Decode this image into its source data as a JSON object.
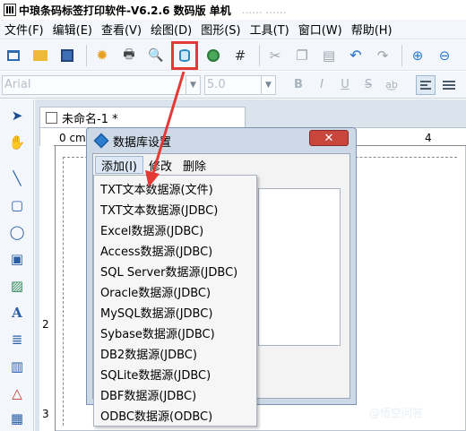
{
  "window": {
    "title": "中琅条码标签打印软件-V6.2.6 数码版 单机",
    "title_faded": "...... ......"
  },
  "menubar": {
    "items": [
      "文件(F)",
      "编辑(E)",
      "查看(V)",
      "绘图(D)",
      "图形(S)",
      "工具(T)",
      "窗口(W)",
      "帮助(H)"
    ]
  },
  "toolbar2": {
    "font_name": "Arial",
    "font_size": "5.0",
    "bold": "B",
    "italic": "I",
    "underline": "U",
    "strike": "S"
  },
  "document": {
    "tab_title": "未命名-1 *",
    "ruler_origin": "0 cm",
    "ruler_h4": "4",
    "ruler_v2": "2",
    "ruler_v3": "3"
  },
  "dialog": {
    "title": "数据库设置",
    "close_label": "✕",
    "menu": [
      "添加(I)",
      "修改",
      "删除"
    ]
  },
  "dropdown": {
    "items": [
      "TXT文本数据源(文件)",
      "TXT文本数据源(JDBC)",
      "Excel数据源(JDBC)",
      "Access数据源(JDBC)",
      "SQL Server数据源(JDBC)",
      "Oracle数据源(JDBC)",
      "MySQL数据源(JDBC)",
      "Sybase数据源(JDBC)",
      "DB2数据源(JDBC)",
      "SQLite数据源(JDBC)",
      "DBF数据源(JDBC)",
      "ODBC数据源(ODBC)"
    ]
  },
  "watermark": "@悟空问答",
  "colors": {
    "highlight": "#e53935",
    "arrow": "#e53935",
    "dialog_frame": "#cdd9e6",
    "close_button": "#c9463c"
  }
}
